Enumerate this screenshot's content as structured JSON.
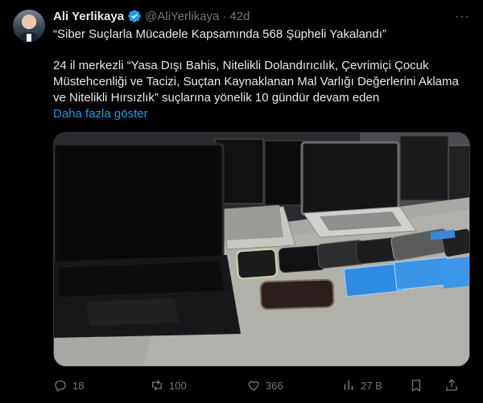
{
  "tweet": {
    "author_name": "Ali Yerlikaya",
    "author_handle": "@AliYerlikaya",
    "separator": "·",
    "time": "42d",
    "more_label": "···",
    "lines": [
      "“Siber Suçlarla Mücadele Kapsamında 568 Şüpheli Yakalandı”",
      "24 il merkezli “Yasa Dışı Bahis, Nitelikli Dolandırıcılık, Çevrimiçi Çocuk",
      "Müstehcenliği ve Tacizi, Suçtan Kaynaklanan Mal Varlığı Değerlerini Aklama",
      "ve Nitelikli Hırsızlık” suçlarına yönelik 10 gündür devam eden"
    ],
    "show_more": "Daha fazla göster"
  },
  "actions": {
    "replies": "18",
    "reposts": "100",
    "likes": "366",
    "views": "27 B"
  },
  "colors": {
    "background": "#000000",
    "text": "#e7e9ea",
    "muted": "#71767b",
    "accent": "#1d9bf0"
  },
  "icons": [
    "verified-badge-icon",
    "more-icon",
    "reply-icon",
    "repost-icon",
    "like-icon",
    "views-icon",
    "bookmark-icon",
    "share-icon"
  ]
}
